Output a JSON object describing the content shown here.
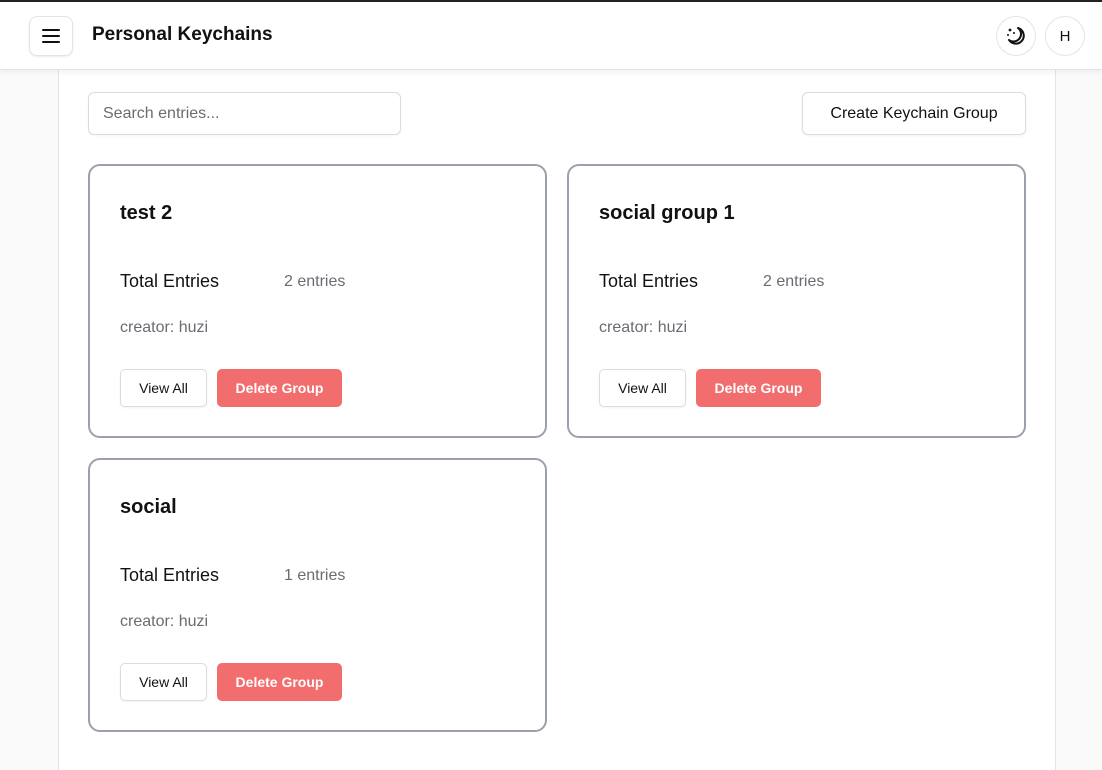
{
  "header": {
    "title": "Personal Keychains",
    "menu_icon": "hamburger-menu-icon",
    "theme_icon": "moon-stars-icon",
    "avatar_initial": "H"
  },
  "toolbar": {
    "search_placeholder": "Search entries...",
    "create_label": "Create Keychain Group"
  },
  "groups": [
    {
      "name": "test 2",
      "total_label": "Total Entries",
      "count": "2 entries",
      "creator": "creator: huzi",
      "view_label": "View All",
      "delete_label": "Delete Group"
    },
    {
      "name": "social group 1",
      "total_label": "Total Entries",
      "count": "2 entries",
      "creator": "creator: huzi",
      "view_label": "View All",
      "delete_label": "Delete Group"
    },
    {
      "name": "social",
      "total_label": "Total Entries",
      "count": "1 entries",
      "creator": "creator: huzi",
      "view_label": "View All",
      "delete_label": "Delete Group"
    }
  ],
  "colors": {
    "delete": "#f26d6d",
    "card_border": "#9aa1ad",
    "muted_text": "#6b6b73"
  }
}
